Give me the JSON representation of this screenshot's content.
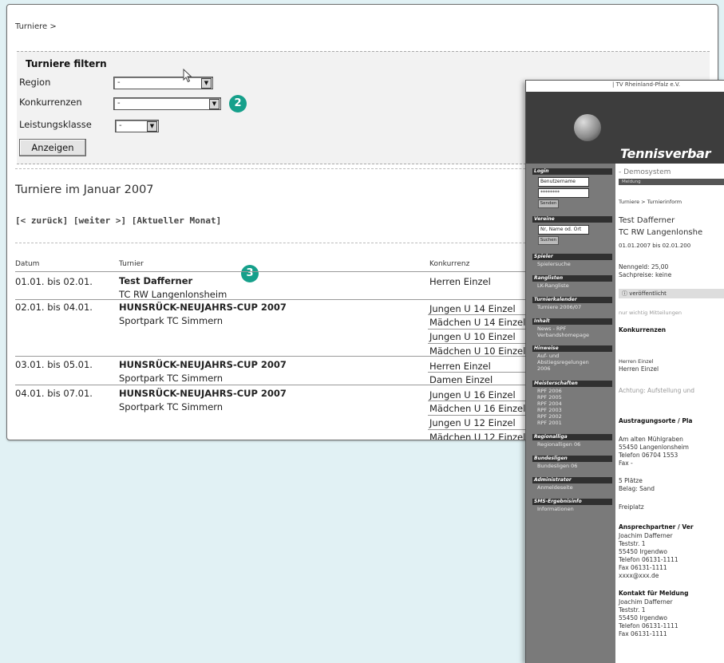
{
  "main": {
    "breadcrumb": "Turniere >",
    "filter": {
      "title": "Turniere filtern",
      "region_label": "Region",
      "region_value": "-",
      "konkurrenzen_label": "Konkurrenzen",
      "konkurrenzen_value": "-",
      "leistungsklasse_label": "Leistungsklasse",
      "leistungsklasse_value": "-",
      "button": "Anzeigen"
    },
    "badges": [
      "2",
      "3"
    ],
    "month_title": "Turniere im Januar 2007",
    "nav": "[< zurück] [weiter >] [Aktueller Monat]",
    "columns": [
      "Datum",
      "Turnier",
      "Konkurrenz"
    ],
    "rows": [
      {
        "date": "01.01. bis 02.01.",
        "name": "Test Dafferner",
        "venue": "TC RW Langenlonsheim",
        "konkurrenz": [
          "Herren Einzel"
        ]
      },
      {
        "date": "02.01. bis 04.01.",
        "name": "HUNSRÜCK-NEUJAHRS-CUP 2007",
        "venue": "Sportpark TC Simmern",
        "konkurrenz": [
          "Jungen U 14 Einzel",
          "Mädchen U 14 Einzel",
          "Jungen U 10 Einzel",
          "Mädchen U 10 Einzel"
        ]
      },
      {
        "date": "03.01. bis 05.01.",
        "name": "HUNSRÜCK-NEUJAHRS-CUP 2007",
        "venue": "Sportpark TC Simmern",
        "konkurrenz": [
          "Herren Einzel",
          "Damen Einzel"
        ]
      },
      {
        "date": "04.01. bis 07.01.",
        "name": "HUNSRÜCK-NEUJAHRS-CUP 2007",
        "venue": "Sportpark TC Simmern",
        "konkurrenz": [
          "Jungen U 16 Einzel",
          "Mädchen U 16 Einzel",
          "Jungen U 12 Einzel",
          "Mädchen U 12 Einzel"
        ]
      }
    ]
  },
  "secondary": {
    "topbar": "| TV Rheinland-Pfalz e.V.",
    "brand": "Tennisverbar",
    "sub": "- Demosystem",
    "tab": "Meldung",
    "crumb": "Turniere > Turnierinform",
    "title": "Test Dafferner",
    "club": "TC RW Langenlonshe",
    "dates": "01.01.2007 bis 02.01.200",
    "fee": "Nenngeld: 25,00",
    "prizes": "Sachpreise: keine",
    "published": "veröffentlicht",
    "notes": "nur wichtig Mitteilungen",
    "konk_title": "Konkurrenzen",
    "konk_head": "Herren Einzel",
    "konk_val": "Herren Einzel",
    "achtung": "Achtung: Aufstellung und",
    "orte_title": "Austragungsorte / Pla",
    "addr1": "Am alten Mühlgraben",
    "addr2": "55450 Langenlonsheim",
    "addr3": "Telefon 06704 1553",
    "addr4": "Fax -",
    "plaetze": "5 Plätze",
    "belag": "Belag: Sand",
    "freiplatz": "Freiplatz",
    "ansp_title": "Ansprechpartner / Ver",
    "a1": "Joachim Dafferner",
    "a2": "Teststr. 1",
    "a3": "55450 Irgendwo",
    "a4": "Telefon 06131-1111",
    "a5": "Fax 06131-1111",
    "a6": "xxxx@xxx.de",
    "kontakt_title": "Kontakt für Meldung",
    "k1": "Joachim Dafferner",
    "k2": "Teststr. 1",
    "k3": "55450 Irgendwo",
    "k4": "Telefon 06131-1111",
    "k5": "Fax 06131-1111",
    "sidebar": {
      "login": "Login",
      "user_ph": "Benutzername",
      "pass": "********",
      "senden": "Senden",
      "vereine": "Vereine",
      "vereine_ph": "Nr, Name od. Ort",
      "suchen": "Suchen",
      "spieler": "Spieler",
      "spielersuche": "Spielersuche",
      "ranglisten": "Ranglisten",
      "lk": "LK-Rangliste",
      "turnierkalender": "Turnierkalender",
      "turniere": "Turniere 2006/07",
      "inhalt": "Inhalt",
      "news": "News - RPF",
      "verband": "Verbandshomepage",
      "hinweise": "Hinweise",
      "auf1": "Auf- und",
      "auf2": "Abstiegsregelungen",
      "auf3": "2006",
      "meister": "Meisterschaften",
      "rpf": [
        "RPF 2006",
        "RPF 2005",
        "RPF 2004",
        "RPF 2003",
        "RPF 2002",
        "RPF 2001"
      ],
      "regionalliga": "Regionalliga",
      "regionalligen": "Regionalligen 06",
      "bundesligen": "Bundesligen",
      "bundesligen06": "Bundesligen 06",
      "admin": "Administrator",
      "anmelde": "Anmeldeseite",
      "sms": "SMS-Ergebnisinfo",
      "info": "Informationen"
    }
  }
}
